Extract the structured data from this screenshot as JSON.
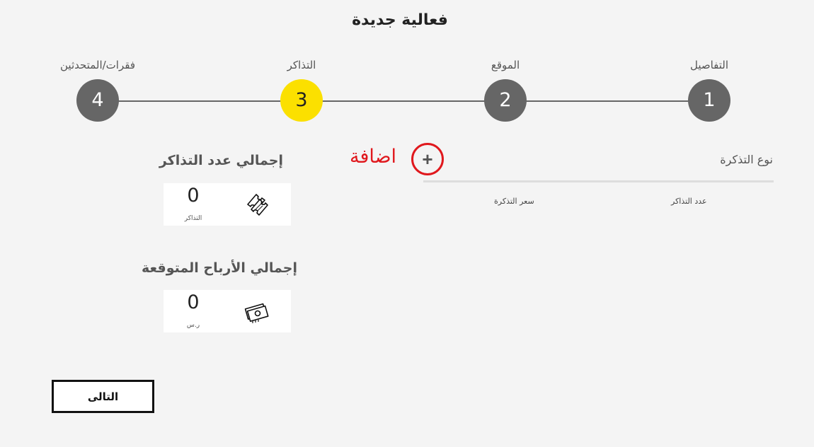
{
  "page": {
    "title": "فعالية جديدة"
  },
  "stepper": {
    "steps": [
      {
        "number": "1",
        "label": "التفاصيل",
        "active": false
      },
      {
        "number": "2",
        "label": "الموقع",
        "active": false
      },
      {
        "number": "3",
        "label": "التذاكر",
        "active": true
      },
      {
        "number": "4",
        "label": "فقرات/المتحدثين",
        "active": false
      }
    ],
    "active_color": "#fbe000",
    "inactive_color": "#666666"
  },
  "tickets": {
    "type_label": "نوع التذكرة",
    "add_label": "اضافة",
    "add_icon": "plus-icon",
    "accent_color": "#e0181d",
    "columns": {
      "count": "عدد التذاكر",
      "price": "سعر التذكرة"
    }
  },
  "summary": {
    "tickets_total": {
      "title": "إجمالي عدد التذاكر",
      "value": "0",
      "unit": "التذاكر",
      "icon": "ticket-icon"
    },
    "profit_total": {
      "title": "إجمالي الأرباح المتوقعة",
      "value": "0",
      "unit": "ر.س",
      "icon": "money-icon"
    }
  },
  "next_button": {
    "label": "التالى"
  }
}
